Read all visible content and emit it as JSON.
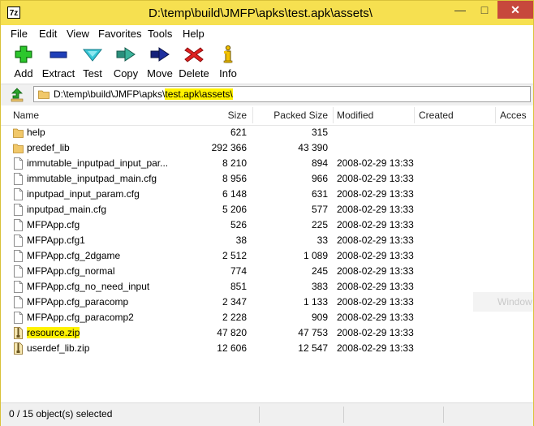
{
  "window": {
    "title": "D:\\temp\\build\\JMFP\\apks\\test.apk\\assets\\",
    "app_icon_text": "7z",
    "minimize_symbol": "—",
    "maximize_symbol": "□",
    "close_symbol": "✕",
    "highlight_color": "#fff200",
    "titlebar_color": "#f6e050"
  },
  "menu": [
    "File",
    "Edit",
    "View",
    "Favorites",
    "Tools",
    "Help"
  ],
  "toolbar": {
    "buttons": [
      {
        "label": "Add",
        "icon": "plus-icon"
      },
      {
        "label": "Extract",
        "icon": "minus-icon"
      },
      {
        "label": "Test",
        "icon": "check-chevron-icon"
      },
      {
        "label": "Copy",
        "icon": "copy-arrow-icon"
      },
      {
        "label": "Move",
        "icon": "move-arrow-icon"
      },
      {
        "label": "Delete",
        "icon": "delete-x-icon"
      },
      {
        "label": "Info",
        "icon": "info-icon"
      }
    ]
  },
  "address": {
    "path_prefix": "D:\\temp\\build\\JMFP\\apks\\",
    "path_highlighted": "test.apk\\assets\\"
  },
  "columns": {
    "name": "Name",
    "size": "Size",
    "packed": "Packed Size",
    "modified": "Modified",
    "created": "Created",
    "accessed": "Acces"
  },
  "files": [
    {
      "name": "help",
      "type": "folder",
      "size": "621",
      "packed": "315",
      "modified": "",
      "highlighted": false
    },
    {
      "name": "predef_lib",
      "type": "folder",
      "size": "292 366",
      "packed": "43 390",
      "modified": "",
      "highlighted": false
    },
    {
      "name": "immutable_inputpad_input_par...",
      "type": "file",
      "size": "8 210",
      "packed": "894",
      "modified": "2008-02-29 13:33",
      "highlighted": false
    },
    {
      "name": "immutable_inputpad_main.cfg",
      "type": "file",
      "size": "8 956",
      "packed": "966",
      "modified": "2008-02-29 13:33",
      "highlighted": false
    },
    {
      "name": "inputpad_input_param.cfg",
      "type": "file",
      "size": "6 148",
      "packed": "631",
      "modified": "2008-02-29 13:33",
      "highlighted": false
    },
    {
      "name": "inputpad_main.cfg",
      "type": "file",
      "size": "5 206",
      "packed": "577",
      "modified": "2008-02-29 13:33",
      "highlighted": false
    },
    {
      "name": "MFPApp.cfg",
      "type": "file",
      "size": "526",
      "packed": "225",
      "modified": "2008-02-29 13:33",
      "highlighted": false
    },
    {
      "name": "MFPApp.cfg1",
      "type": "file",
      "size": "38",
      "packed": "33",
      "modified": "2008-02-29 13:33",
      "highlighted": false
    },
    {
      "name": "MFPApp.cfg_2dgame",
      "type": "file",
      "size": "2 512",
      "packed": "1 089",
      "modified": "2008-02-29 13:33",
      "highlighted": false
    },
    {
      "name": "MFPApp.cfg_normal",
      "type": "file",
      "size": "774",
      "packed": "245",
      "modified": "2008-02-29 13:33",
      "highlighted": false
    },
    {
      "name": "MFPApp.cfg_no_need_input",
      "type": "file",
      "size": "851",
      "packed": "383",
      "modified": "2008-02-29 13:33",
      "highlighted": false
    },
    {
      "name": "MFPApp.cfg_paracomp",
      "type": "file",
      "size": "2 347",
      "packed": "1 133",
      "modified": "2008-02-29 13:33",
      "highlighted": false
    },
    {
      "name": "MFPApp.cfg_paracomp2",
      "type": "file",
      "size": "2 228",
      "packed": "909",
      "modified": "2008-02-29 13:33",
      "highlighted": false
    },
    {
      "name": "resource.zip",
      "type": "zip",
      "size": "47 820",
      "packed": "47 753",
      "modified": "2008-02-29 13:33",
      "highlighted": true
    },
    {
      "name": "userdef_lib.zip",
      "type": "zip",
      "size": "12 606",
      "packed": "12 547",
      "modified": "2008-02-29 13:33",
      "highlighted": false
    }
  ],
  "watermark_text": "Window",
  "status": {
    "text": "0 / 15 object(s) selected"
  }
}
